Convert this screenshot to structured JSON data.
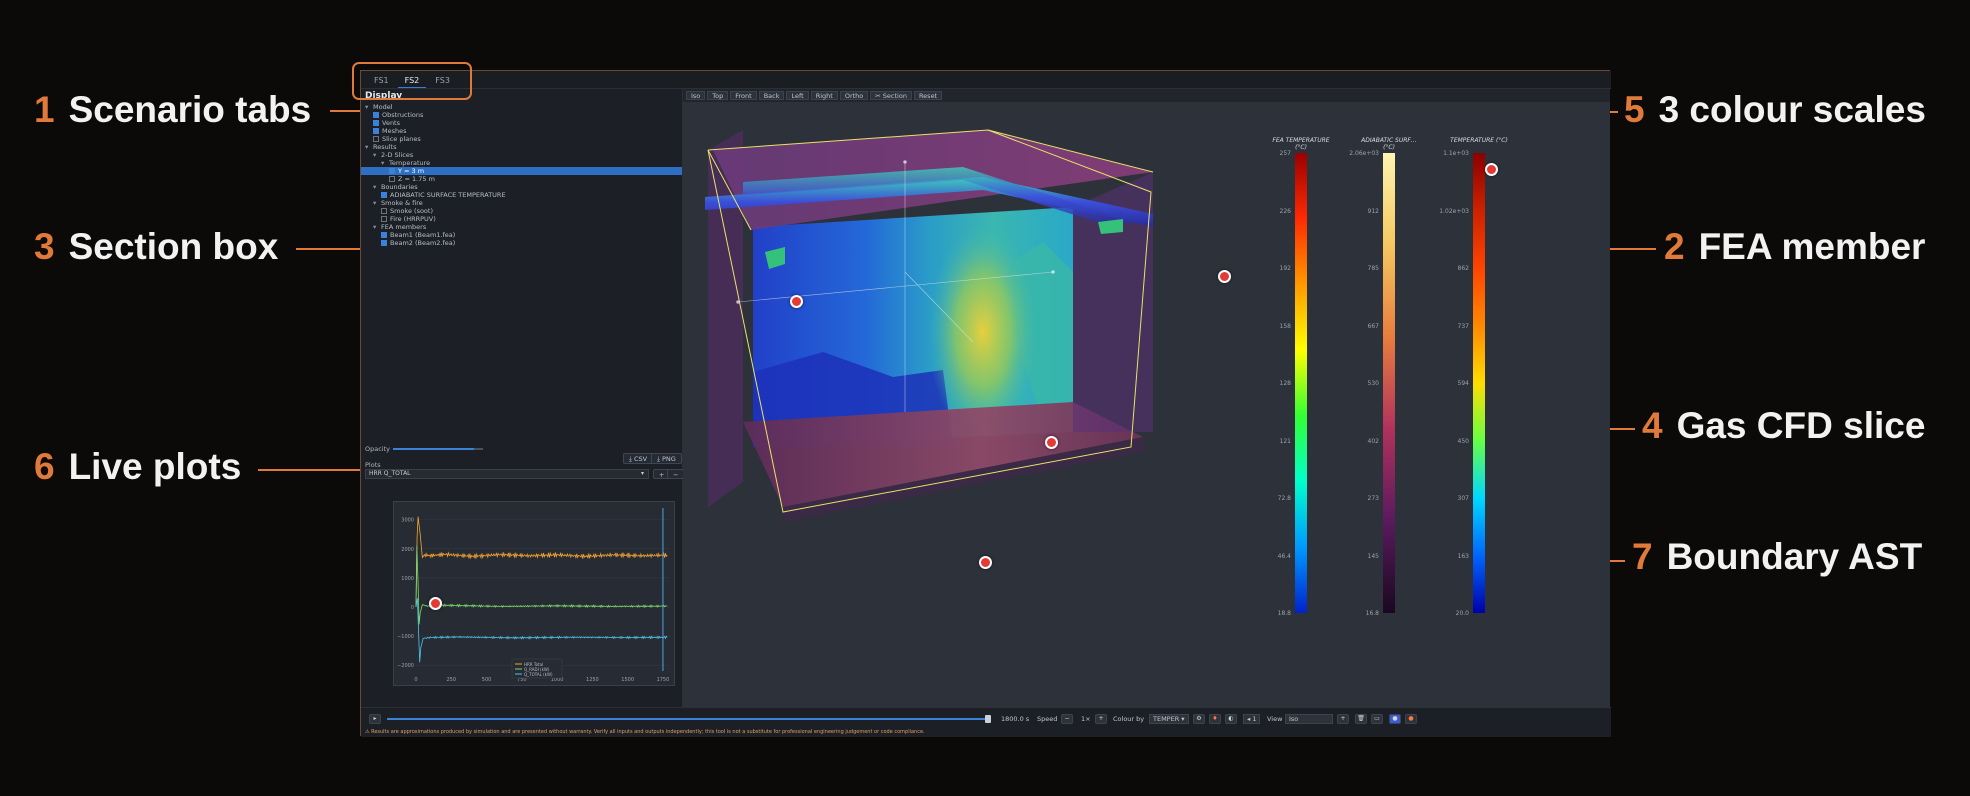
{
  "callouts": [
    {
      "num": "1",
      "label": "Scenario tabs"
    },
    {
      "num": "2",
      "label": "FEA member"
    },
    {
      "num": "3",
      "label": "Section box"
    },
    {
      "num": "4",
      "label": "Gas CFD slice"
    },
    {
      "num": "5",
      "label": "3 colour scales"
    },
    {
      "num": "6",
      "label": "Live plots"
    },
    {
      "num": "7",
      "label": "Boundary AST"
    }
  ],
  "tabs": [
    "FS1",
    "FS2",
    "FS3"
  ],
  "display": {
    "title": "Display",
    "tree": [
      {
        "label": "Model",
        "level": 0,
        "toggle": "▾"
      },
      {
        "label": "Obstructions",
        "level": 1,
        "check": true
      },
      {
        "label": "Vents",
        "level": 1,
        "check": true
      },
      {
        "label": "Meshes",
        "level": 1,
        "check": true
      },
      {
        "label": "Slice planes",
        "level": 1,
        "check": false
      },
      {
        "label": "Results",
        "level": 0,
        "toggle": "▾"
      },
      {
        "label": "2-D Slices",
        "level": 1,
        "toggle": "▾"
      },
      {
        "label": "Temperature",
        "level": 2,
        "toggle": "▾"
      },
      {
        "label": "Y = 3 m",
        "level": 3,
        "check": true,
        "selected": true
      },
      {
        "label": "Z = 1.75 m",
        "level": 3,
        "check": false
      },
      {
        "label": "Boundaries",
        "level": 1,
        "toggle": "▾"
      },
      {
        "label": "ADIABATIC SURFACE TEMPERATURE",
        "level": 2,
        "check": true
      },
      {
        "label": "Smoke & fire",
        "level": 1,
        "toggle": "▾"
      },
      {
        "label": "Smoke (soot)",
        "level": 2,
        "check": false
      },
      {
        "label": "Fire (HRRPUV)",
        "level": 2,
        "check": false
      },
      {
        "label": "FEA members",
        "level": 1,
        "toggle": "▾"
      },
      {
        "label": "Beam1 (Beam1.fea)",
        "level": 2,
        "check": true
      },
      {
        "label": "Beam2 (Beam2.fea)",
        "level": 2,
        "check": true
      }
    ],
    "opacity_label": "Opacity",
    "opacity": 0.9
  },
  "plots": {
    "title": "Plots",
    "csv_label": "⤓ CSV",
    "png_label": "⤓ PNG",
    "selected_series": "HRR Q_TOTAL",
    "add_label": "+",
    "remove_label": "−"
  },
  "chart_data": {
    "type": "line",
    "x_ticks": [
      "0",
      "250",
      "500",
      "750",
      "1000",
      "1250",
      "1500",
      "1750"
    ],
    "y_ticks": [
      "3000",
      "2000",
      "1000",
      "0",
      "−1000",
      "−2000"
    ],
    "xlim": [
      0,
      1800
    ],
    "ylim": [
      -2200,
      3400
    ],
    "current_time": 1750,
    "legend": [
      "HRR Total",
      "Q_RADI (kW)",
      "Q_TOTAL (kW)"
    ],
    "series": [
      {
        "name": "HRR Total",
        "color": "#f5a431",
        "points": [
          [
            0,
            0
          ],
          [
            8,
            2400
          ],
          [
            15,
            3100
          ],
          [
            22,
            2800
          ],
          [
            30,
            2500
          ],
          [
            45,
            1700
          ],
          [
            60,
            1800
          ],
          [
            100,
            1760
          ],
          [
            200,
            1810
          ],
          [
            400,
            1740
          ],
          [
            600,
            1800
          ],
          [
            800,
            1760
          ],
          [
            1000,
            1790
          ],
          [
            1200,
            1740
          ],
          [
            1400,
            1790
          ],
          [
            1600,
            1760
          ],
          [
            1780,
            1780
          ]
        ]
      },
      {
        "name": "Q_RADI (kW)",
        "color": "#7fdc6a",
        "points": [
          [
            0,
            0
          ],
          [
            6,
            2100
          ],
          [
            14,
            900
          ],
          [
            22,
            -600
          ],
          [
            30,
            -200
          ],
          [
            45,
            80
          ],
          [
            80,
            30
          ],
          [
            200,
            60
          ],
          [
            600,
            20
          ],
          [
            1000,
            40
          ],
          [
            1400,
            20
          ],
          [
            1780,
            30
          ]
        ]
      },
      {
        "name": "Q_TOTAL (kW)",
        "color": "#4fc4e8",
        "points": [
          [
            0,
            0
          ],
          [
            10,
            300
          ],
          [
            18,
            -800
          ],
          [
            26,
            -1900
          ],
          [
            34,
            -1400
          ],
          [
            50,
            -1080
          ],
          [
            100,
            -1050
          ],
          [
            300,
            -1030
          ],
          [
            700,
            -1060
          ],
          [
            1100,
            -1040
          ],
          [
            1500,
            -1050
          ],
          [
            1780,
            -1040
          ]
        ]
      }
    ]
  },
  "viewport": {
    "buttons": [
      "Iso",
      "Top",
      "Front",
      "Back",
      "Left",
      "Right",
      "Ortho",
      "✂ Section",
      "Reset"
    ]
  },
  "scales": [
    {
      "title": "FEA TEMPERATURE (°C)",
      "ticks": [
        "257",
        "226",
        "192",
        "158",
        "128",
        "121",
        "72.8",
        "46.4",
        "18.8"
      ],
      "colors": [
        "#9b0000",
        "#ff2a00",
        "#ff9900",
        "#ffff00",
        "#33ff33",
        "#00ffcc",
        "#0099ff",
        "#0022cc"
      ]
    },
    {
      "title": "ADIABATIC SURF… (°C)",
      "ticks": [
        "2.06e+03",
        "912",
        "785",
        "667",
        "530",
        "402",
        "273",
        "145",
        "16.8"
      ],
      "colors": [
        "#fff4b0",
        "#f5c760",
        "#e87d3e",
        "#b0325c",
        "#5a1a5e",
        "#1a0820"
      ]
    },
    {
      "title": "TEMPERATURE (°C)",
      "ticks": [
        "1.1e+03",
        "1.02e+03",
        "862",
        "737",
        "594",
        "450",
        "307",
        "163",
        "20.0"
      ],
      "colors": [
        "#8b0000",
        "#cc2200",
        "#ff4400",
        "#ff8800",
        "#ffdd00",
        "#66ff44",
        "#00d8ff",
        "#0066ff",
        "#0000aa"
      ]
    }
  ],
  "bottom": {
    "play_label": "▸",
    "time_value": "1800.0 s",
    "speed_label": "Speed",
    "speed_value": "1×",
    "colour_by_label": "Colour by",
    "colour_by_value": "TEMPER ▾",
    "view_label": "View",
    "view_value": "Iso",
    "step_label": "◂ 1",
    "disclaimer": "⚠ Results are approximations produced by simulation and are presented without warranty. Verify all inputs and outputs independently; this tool is not a substitute for professional engineering judgement or code compliance."
  }
}
